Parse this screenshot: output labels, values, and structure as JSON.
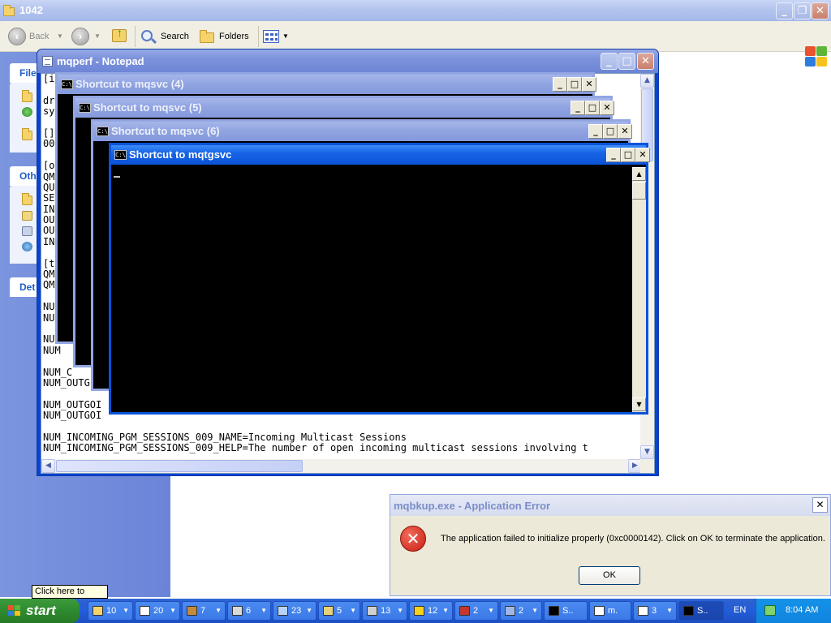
{
  "explorer": {
    "title": "1042",
    "toolbar": {
      "back_label": "Back",
      "search_label": "Search",
      "folders_label": "Folders"
    },
    "left_pane": {
      "panel1_head": "File",
      "panel2_head": "Oth",
      "panel3_head": "Det"
    }
  },
  "notepad": {
    "title": "mqperf - Notepad",
    "lines": [
      "[i",
      "",
      "dr",
      "sy",
      "",
      "[]",
      "00",
      "",
      "[o",
      "QM",
      "QU",
      "SE",
      "IN",
      "OU",
      "OU",
      "IN",
      "",
      "[t",
      "QM",
      "QM",
      "",
      "NUM",
      "NUM",
      "",
      "NUM",
      "NUM",
      "",
      "NUM_C",
      "NUM_OUTG",
      "",
      "NUM_OUTGOI",
      "NUM_OUTGOI",
      "",
      "NUM_INCOMING_PGM_SESSIONS_009_NAME=Incoming Multicast Sessions",
      "NUM_INCOMING_PGM_SESSIONS_009_HELP=The number of open incoming multicast sessions involving t"
    ]
  },
  "consoles": [
    {
      "title": "Shortcut to mqsvc (4)"
    },
    {
      "title": "Shortcut to mqsvc (5)"
    },
    {
      "title": "Shortcut to mqsvc (6)"
    },
    {
      "title": "Shortcut to mqtgsvc"
    }
  ],
  "error_dialog": {
    "title": "mqbkup.exe - Application Error",
    "message": "The application failed to initialize properly (0xc0000142). Click on OK to terminate the application.",
    "ok_label": "OK"
  },
  "tooltip": "Click here to begin",
  "taskbar": {
    "start_label": "start",
    "buttons": [
      {
        "label": "10",
        "icon": "folder-icon",
        "color": "#f3d36a"
      },
      {
        "label": "20",
        "icon": "window-icon",
        "color": "#ffffff"
      },
      {
        "label": "7",
        "icon": "tools-icon",
        "color": "#c78a3b"
      },
      {
        "label": "6",
        "icon": "wizard-icon",
        "color": "#d9d9d9"
      },
      {
        "label": "23",
        "icon": "document-icon",
        "color": "#b7d3f5"
      },
      {
        "label": "5",
        "icon": "printer-icon",
        "color": "#e8d37a"
      },
      {
        "label": "13",
        "icon": "network-icon",
        "color": "#cfcfcf"
      },
      {
        "label": "12",
        "icon": "help-icon",
        "color": "#f7d21c"
      },
      {
        "label": "2",
        "icon": "toolbox-icon",
        "color": "#c9362b"
      },
      {
        "label": "2",
        "icon": "computer-icon",
        "color": "#9fb7e6"
      },
      {
        "label": "S..",
        "icon": "console-icon",
        "color": "#000000"
      },
      {
        "label": "m.",
        "icon": "notepad-icon",
        "color": "#ffffff"
      },
      {
        "label": "3",
        "icon": "window-icon",
        "color": "#ffffff"
      },
      {
        "label": "S..",
        "icon": "console-icon",
        "color": "#000000"
      }
    ],
    "language": "EN",
    "clock": "8:04 AM"
  }
}
